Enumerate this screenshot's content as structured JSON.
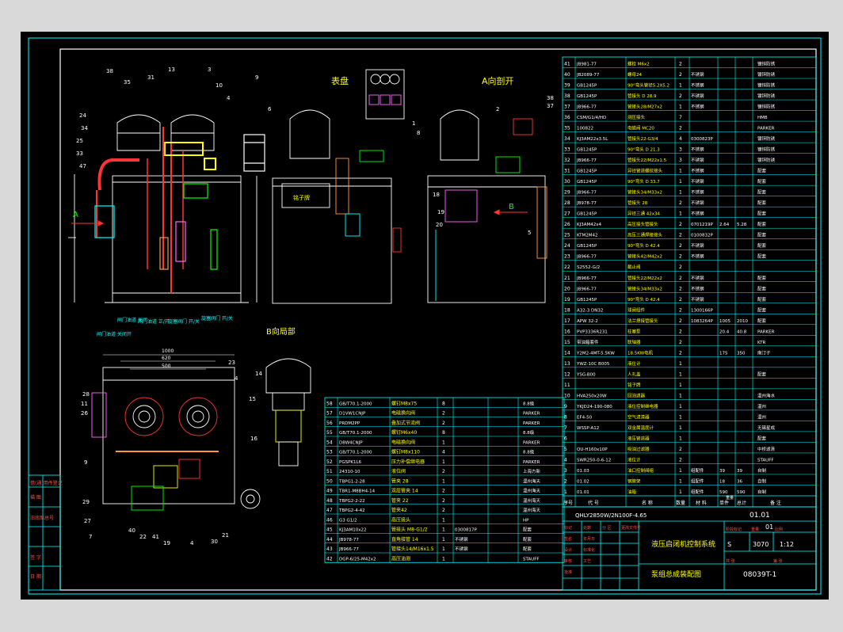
{
  "drawing": {
    "views": {
      "gauge_panel": "表盘",
      "view_a": "A向剖开",
      "view_b": "B向局部"
    },
    "arrows": {
      "a": "A",
      "b": "B"
    },
    "tank_label": "铭子牌",
    "dims": {
      "width_1": "1000",
      "width_2": "620",
      "width_3": "500"
    },
    "leaders_main": [
      "38",
      "35",
      "34",
      "24",
      "33",
      "47",
      "25",
      "31",
      "13",
      "10",
      "4",
      "6",
      "9",
      "3"
    ],
    "leaders_view_a": [
      "1",
      "2",
      "8",
      "37",
      "38",
      "18",
      "19",
      "20",
      "5"
    ],
    "leaders_bottom": [
      "28",
      "11",
      "26",
      "29",
      "9",
      "27",
      "7",
      "40",
      "22",
      "41",
      "19",
      "4",
      "30",
      "21",
      "4",
      "23"
    ],
    "leaders_view_b": [
      "14",
      "15",
      "16"
    ],
    "valve_labels": [
      "闸门油道\n关闭开",
      "闸门油道\n关闭",
      "闸门油道\n正/开",
      "旋塞阀门\n开/关",
      "旋塞阀门\n开/关"
    ]
  },
  "bom_right": {
    "rows": [
      {
        "no": "41",
        "code": "JB981-77",
        "name": "螺栓 M6x2",
        "qty": "2",
        "mat": "",
        "note": "",
        "note2": "",
        "rem": "镀锌防锈"
      },
      {
        "no": "40",
        "code": "JB2089-77",
        "name": "螺母24",
        "qty": "2",
        "mat": "不锈钢",
        "note": "",
        "note2": "",
        "rem": "镀锌防锈"
      },
      {
        "no": "39",
        "code": "GB1245P",
        "name": "90°弯头管径5.2X5.2",
        "qty": "1",
        "mat": "不锈钢",
        "note": "",
        "note2": "",
        "rem": "镀锌防锈"
      },
      {
        "no": "38",
        "code": "GB1245P",
        "name": "管接头 D 28.9",
        "qty": "2",
        "mat": "不锈钢",
        "note": "",
        "note2": "",
        "rem": "镀锌防锈"
      },
      {
        "no": "37",
        "code": "JB966-77",
        "name": "管接头28/M27x2",
        "qty": "1",
        "mat": "不锈钢",
        "note": "",
        "note2": "",
        "rem": "镀锌防锈"
      },
      {
        "no": "36",
        "code": "CSM/G1/4/HD",
        "name": "测压接头",
        "qty": "7",
        "mat": "",
        "note": "",
        "note2": "",
        "rem": "HMB"
      },
      {
        "no": "35",
        "code": "100822",
        "name": "电磁阀 MC20",
        "qty": "2",
        "mat": "",
        "note": "",
        "note2": "",
        "rem": "PARKER"
      },
      {
        "no": "34",
        "code": "KJ3AM22x3.5L",
        "name": "管接头22-G3/4",
        "qty": "4",
        "mat": "0300823P",
        "note": "",
        "note2": "",
        "rem": "镀锌防锈"
      },
      {
        "no": "33",
        "code": "GB1245P",
        "name": "90°弯头 D 21.3",
        "qty": "3",
        "mat": "不锈钢",
        "note": "",
        "note2": "",
        "rem": "镀锌防锈"
      },
      {
        "no": "32",
        "code": "JB966-77",
        "name": "管接头22/M22x1.5",
        "qty": "3",
        "mat": "不锈钢",
        "note": "",
        "note2": "",
        "rem": "镀锌防锈"
      },
      {
        "no": "31",
        "code": "GB1245P",
        "name": "异径管道螺纹接头",
        "qty": "1",
        "mat": "不锈钢",
        "note": "",
        "note2": "",
        "rem": "配套"
      },
      {
        "no": "30",
        "code": "GB1245P",
        "name": "90°弯头 D 33.7",
        "qty": "1",
        "mat": "不锈钢",
        "note": "",
        "note2": "",
        "rem": "配套"
      },
      {
        "no": "29",
        "code": "JB966-77",
        "name": "管接头34/M33x2",
        "qty": "1",
        "mat": "不锈钢",
        "note": "",
        "note2": "",
        "rem": "配套"
      },
      {
        "no": "28",
        "code": "JB978-77",
        "name": "管接头 28",
        "qty": "2",
        "mat": "不锈钢",
        "note": "",
        "note2": "",
        "rem": "配套"
      },
      {
        "no": "27",
        "code": "GB1245P",
        "name": "异径三通 42x34",
        "qty": "1",
        "mat": "不锈钢",
        "note": "",
        "note2": "",
        "rem": "配套"
      },
      {
        "no": "26",
        "code": "KJ3AM42x4",
        "name": "高压接头管接头",
        "qty": "2",
        "mat": "0701219P",
        "note": "2.64",
        "note2": "5.28",
        "rem": "配套"
      },
      {
        "no": "25",
        "code": "KTM2M42",
        "name": "高压三通焊接接头",
        "qty": "2",
        "mat": "0100832P",
        "note": "",
        "note2": "",
        "rem": "配套"
      },
      {
        "no": "24",
        "code": "GB1245P",
        "name": "90°弯头 D 42.4",
        "qty": "2",
        "mat": "不锈钢",
        "note": "",
        "note2": "",
        "rem": "配套"
      },
      {
        "no": "23",
        "code": "JB966-77",
        "name": "管接头42/M42x2",
        "qty": "2",
        "mat": "不锈钢",
        "note": "",
        "note2": "",
        "rem": "配套"
      },
      {
        "no": "22",
        "code": "S2552-G/2",
        "name": "截止阀",
        "qty": "2",
        "mat": "",
        "note": "",
        "note2": "",
        "rem": ""
      },
      {
        "no": "21",
        "code": "JB966-77",
        "name": "管接头22/M22x2",
        "qty": "2",
        "mat": "不锈钢",
        "note": "",
        "note2": "",
        "rem": "配套"
      },
      {
        "no": "20",
        "code": "JB966-77",
        "name": "管接头34/M33x2",
        "qty": "2",
        "mat": "不锈钢",
        "note": "",
        "note2": "",
        "rem": "配套"
      },
      {
        "no": "19",
        "code": "GB1245P",
        "name": "90°弯头 D 42.4",
        "qty": "2",
        "mat": "不锈钢",
        "note": "",
        "note2": "",
        "rem": "配套"
      },
      {
        "no": "18",
        "code": "A32-3 DN32",
        "name": "球阀组件",
        "qty": "2",
        "mat": "1300166P",
        "note": "",
        "note2": "",
        "rem": "配套"
      },
      {
        "no": "17",
        "code": "APW 32-2",
        "name": "法兰焊接管接头",
        "qty": "2",
        "mat": "1083264P",
        "note": "1005",
        "note2": "2010",
        "rem": "配套"
      },
      {
        "no": "16",
        "code": "PVP3336R231",
        "name": "柱塞泵",
        "qty": "2",
        "mat": "",
        "note": "20.4",
        "note2": "40.8",
        "rem": "PARKER"
      },
      {
        "no": "15",
        "code": "带油箱套件",
        "name": "联轴器",
        "qty": "2",
        "mat": "",
        "note": "",
        "note2": "",
        "rem": "KTR"
      },
      {
        "no": "14",
        "code": "Y2M2-4MT-5.5KW",
        "name": "18.5KW电机",
        "qty": "2",
        "mat": "",
        "note": "175",
        "note2": "350",
        "rem": "南汀子"
      },
      {
        "no": "13",
        "code": "YWZ-10C B005",
        "name": "液位计",
        "qty": "1",
        "mat": "",
        "note": "",
        "note2": "",
        "rem": ""
      },
      {
        "no": "12",
        "code": "YSG-B00",
        "name": "人孔盖",
        "qty": "1",
        "mat": "",
        "note": "",
        "note2": "",
        "rem": "配套"
      },
      {
        "no": "11",
        "code": "",
        "name": "铭子牌",
        "qty": "1",
        "mat": "",
        "note": "",
        "note2": "",
        "rem": ""
      },
      {
        "no": "10",
        "code": "HVA250x20W",
        "name": "回油滤器",
        "qty": "1",
        "mat": "",
        "note": "",
        "note2": "",
        "rem": "温州海水"
      },
      {
        "no": "9",
        "code": "YKJD24-190-080",
        "name": "液位控制继电器",
        "qty": "1",
        "mat": "",
        "note": "",
        "note2": "",
        "rem": "温州"
      },
      {
        "no": "8",
        "code": "EF4-50",
        "name": "空气滤清器",
        "qty": "1",
        "mat": "",
        "note": "",
        "note2": "",
        "rem": "温州"
      },
      {
        "no": "7",
        "code": "WSSP-A12",
        "name": "双金属温度计",
        "qty": "1",
        "mat": "",
        "note": "",
        "note2": "",
        "rem": "无锡星成"
      },
      {
        "no": "6",
        "code": "",
        "name": "液压管道器",
        "qty": "1",
        "mat": "",
        "note": "",
        "note2": "",
        "rem": "配套"
      },
      {
        "no": "5",
        "code": "QU-H160x10P",
        "name": "吸油过滤器",
        "qty": "2",
        "mat": "",
        "note": "",
        "note2": "",
        "rem": "中桥滤清"
      },
      {
        "no": "4",
        "code": "SWR250-0-6-12",
        "name": "液位计",
        "qty": "2",
        "mat": "",
        "note": "",
        "note2": "",
        "rem": "STAUFF"
      },
      {
        "no": "3",
        "code": "01.03",
        "name": "油口控制阀组",
        "qty": "1",
        "mat": "组配件",
        "note": "39",
        "note2": "39",
        "rem": "自制"
      },
      {
        "no": "2",
        "code": "01.02",
        "name": "钢管架",
        "qty": "1",
        "mat": "组配件",
        "note": "18",
        "note2": "36",
        "rem": "自制"
      },
      {
        "no": "1",
        "code": "01.01",
        "name": "油箱",
        "qty": "1",
        "mat": "组配件",
        "note": "590",
        "note2": "590",
        "rem": "自制"
      }
    ],
    "header": [
      "序号",
      "代 号",
      "名 称",
      "数量",
      "材 料",
      "单件",
      "总计",
      "备 注"
    ],
    "header_weight": "重量"
  },
  "bom_left": {
    "rows": [
      {
        "no": "58",
        "code": "GB/T70.1-2000",
        "name": "螺钉M8x75",
        "qty": "8",
        "rem": "8.8级"
      },
      {
        "no": "57",
        "code": "D1VW1CNJP",
        "name": "电磁换向阀",
        "qty": "2",
        "rem": "PARKER"
      },
      {
        "no": "56",
        "code": "PRDM2PP",
        "name": "叠加式节流阀",
        "qty": "2",
        "rem": "PARKER"
      },
      {
        "no": "55",
        "code": "GB/T70.1-2000",
        "name": "螺钉M6x40",
        "qty": "8",
        "rem": "8.8级"
      },
      {
        "no": "54",
        "code": "D8W4CNJP",
        "name": "电磁换向阀",
        "qty": "1",
        "rem": "PARKER"
      },
      {
        "no": "53",
        "code": "GB/T70.1-2000",
        "name": "螺钉M8x110",
        "qty": "4",
        "rem": "8.8级"
      },
      {
        "no": "52",
        "code": "PGSPK1L6",
        "name": "压力补偿继电器",
        "qty": "1",
        "rem": "PARKER"
      },
      {
        "no": "51",
        "code": "24310-10",
        "name": "液位阀",
        "qty": "2",
        "rem": "上海方新"
      },
      {
        "no": "50",
        "code": "TBPG1-2-28",
        "name": "管夹 28",
        "qty": "1",
        "rem": "温州海天"
      },
      {
        "no": "49",
        "code": "TBR1-M8BH4-14",
        "name": "双层管夹 14",
        "qty": "2",
        "rem": "温州海天"
      },
      {
        "no": "48",
        "code": "TBPG2-2-22",
        "name": "管夹 22",
        "qty": "2",
        "rem": "温州海天"
      },
      {
        "no": "47",
        "code": "TBPG2-4-42",
        "name": "管夹42",
        "qty": "2",
        "rem": "温州海天"
      },
      {
        "no": "46",
        "code": "G3 G1/2",
        "name": "高压接头",
        "qty": "1",
        "rem": "HP"
      },
      {
        "no": "45",
        "code": "KJ3AM10x22",
        "name": "管接头 M8-G1/2",
        "qty": "1",
        "mat": "0300817P",
        "rem": "配套"
      },
      {
        "no": "44",
        "code": "JB978-77",
        "name": "直角接管 14",
        "qty": "1",
        "mat": "不锈钢",
        "rem": "配套"
      },
      {
        "no": "43",
        "code": "JB966-77",
        "name": "管接头14/M16x1.5",
        "qty": "1",
        "mat": "不锈钢",
        "rem": "配套"
      },
      {
        "no": "42",
        "code": "DGP-6/25-M42x2",
        "name": "高压油测",
        "qty": "1",
        "rem": "STAUFF"
      }
    ]
  },
  "title_block": {
    "drawing_no": "QHLY2850W/2N100F-4.65",
    "part_no": "01.01",
    "title": "液压启闭机控制系统",
    "qty_label": "01",
    "weight": "3070",
    "scale": "1:12",
    "stage": "S",
    "name2": "泵组总成装配图",
    "code2": "08039T-1",
    "labels": [
      "标记",
      "处数",
      "分 区",
      "更改文件号",
      "签名",
      "年月日",
      "设计",
      "标准化",
      "审核",
      "工艺",
      "批准",
      "阶段标记",
      "重量",
      "比例",
      "共 张",
      "第 张"
    ]
  },
  "left_margin": [
    "借(通)用件登记",
    "描 图",
    "旧底图总号",
    "签 字",
    "日 期"
  ]
}
